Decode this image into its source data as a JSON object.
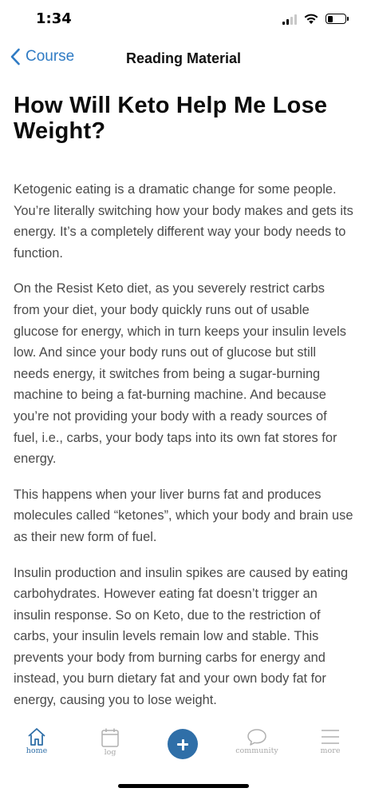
{
  "status_bar": {
    "time": "1:34",
    "signal_icon": "cellular-signal-icon",
    "wifi_icon": "wifi-icon",
    "battery_icon": "battery-icon",
    "battery_level": 0.3
  },
  "nav": {
    "back_label": "Course",
    "back_icon": "chevron-left-icon",
    "title": "Reading Material",
    "accent_color": "#2f7bc4"
  },
  "article": {
    "title": "How Will Keto Help Me Lose Weight?",
    "paragraphs": [
      "Ketogenic eating is a dramatic change for some people. You’re literally switching how your body makes and gets its energy. It’s a completely different way your body needs to function.",
      "On the Resist Keto diet, as you severely restrict carbs from your diet, your body quickly runs out of usable glucose for energy, which in turn keeps your insulin levels low. And since your body runs out of glucose but still needs energy, it switches from being a sugar-burning machine to being a fat-burning machine. And because you’re not providing your body with a ready sources of fuel, i.e., carbs, your body taps into its own fat stores for energy.",
      "This happens when your liver burns fat and produces molecules called “ketones”, which your body and brain use as their new form of fuel.",
      "Insulin production and insulin spikes are caused by eating carbohydrates. However eating fat doesn’t trigger an insulin response. So on Keto, due to the restriction of carbs, your insulin levels remain low and stable. This prevents your body from burning carbs for energy and instead, you burn dietary fat and your own body fat for energy, causing you to lose weight."
    ]
  },
  "tab_bar": {
    "tabs": [
      {
        "label": "home",
        "icon": "home-icon",
        "active": true
      },
      {
        "label": "log",
        "icon": "calendar-icon",
        "active": false
      },
      {
        "label": "",
        "icon": "plus-icon",
        "active": false
      },
      {
        "label": "community",
        "icon": "chat-bubble-icon",
        "active": false
      },
      {
        "label": "more",
        "icon": "menu-icon",
        "active": false
      }
    ],
    "active_color": "#2f6fa8",
    "inactive_color": "#a8a8a8"
  }
}
